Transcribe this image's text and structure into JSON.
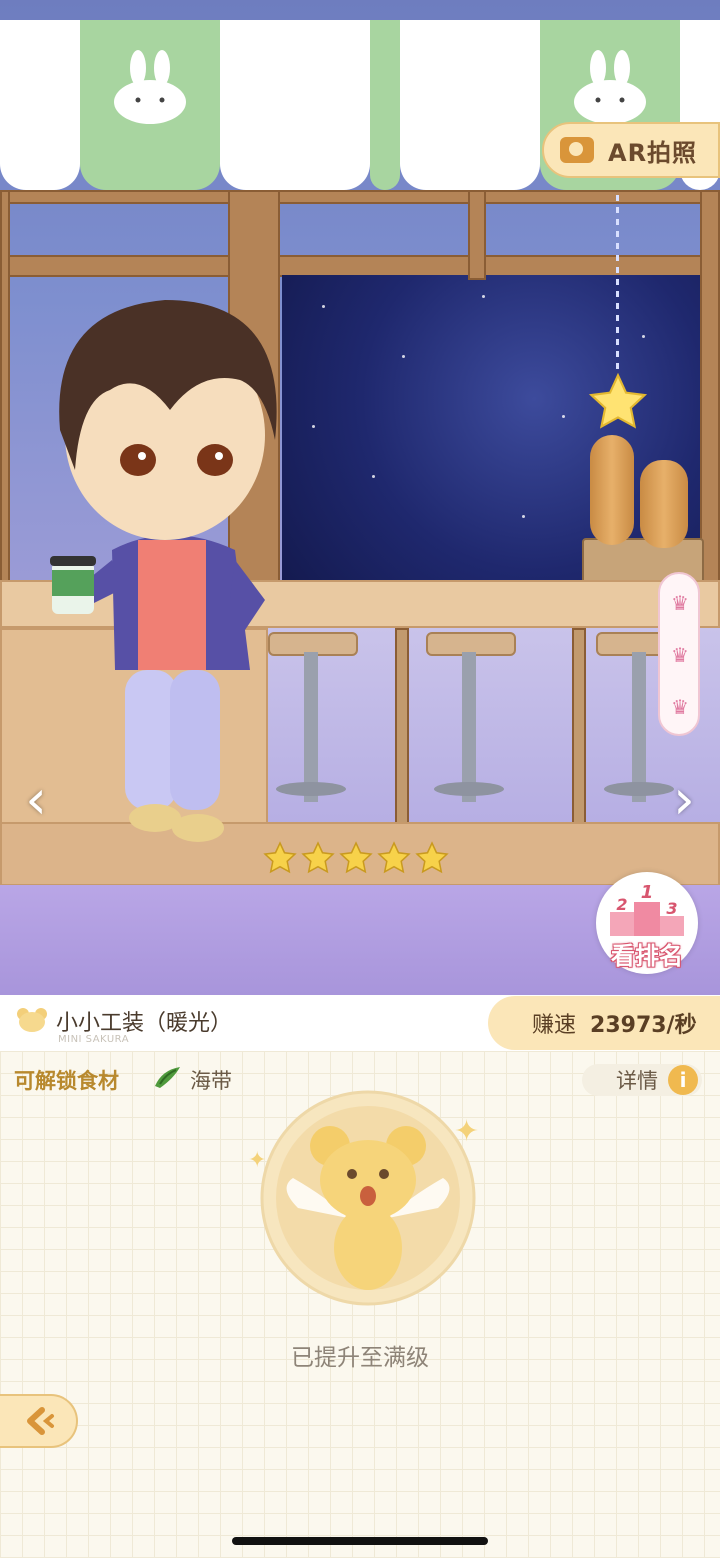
{
  "ar_button": {
    "label": "AR拍照",
    "icon": "camera-icon"
  },
  "rating": {
    "stars": 5,
    "max": 5
  },
  "rank_button": {
    "label": "看排名",
    "podium": [
      "2",
      "1",
      "3"
    ]
  },
  "crowns": [
    "crown-icon",
    "crown-icon",
    "crown-icon"
  ],
  "nav": {
    "prev": "‹",
    "next": "›"
  },
  "character": {
    "name": "小小工装（暖光）",
    "series": "MINI SAKURA"
  },
  "earning": {
    "label": "赚速",
    "value": "23973/秒"
  },
  "unlock": {
    "label": "可解锁食材",
    "food": "海带"
  },
  "detail": {
    "label": "详情",
    "icon_text": "i"
  },
  "status": {
    "text": "已提升至满级"
  },
  "colors": {
    "accent": "#fbe6b8",
    "gold": "#f0b94f",
    "awning_green": "#a8d5a0"
  }
}
